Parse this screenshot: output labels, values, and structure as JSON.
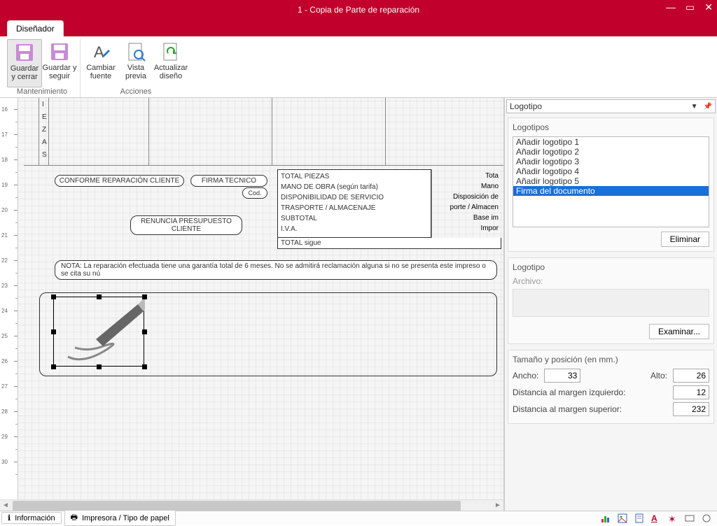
{
  "window": {
    "title": "1 - Copia de Parte de reparación"
  },
  "tab": {
    "designer": "Diseñador"
  },
  "ribbon": {
    "groups": {
      "maintenance": {
        "label": "Mantenimiento",
        "save_close": "Guardar y cerrar",
        "save_continue": "Guardar y seguir"
      },
      "actions": {
        "label": "Acciones",
        "change_font": "Cambiar fuente",
        "preview": "Vista previa",
        "refresh": "Actualizar diseño"
      }
    }
  },
  "ruler": {
    "start": 16,
    "end": 30
  },
  "design": {
    "vertical_letters": [
      "I",
      "E",
      "Z",
      "A",
      "S"
    ],
    "conforme": "CONFORME REPARACIÓN CLIENTE",
    "firma_tecnico": "FIRMA TECNICO",
    "cod": "Cod.",
    "renuncia1": "RENUNCIA PRESUPUESTO",
    "renuncia2": "CLIENTE",
    "totals": [
      "TOTAL PIEZAS",
      "MANO DE OBRA (según tarifa)",
      "DISPONIBILIDAD DE SERVICIO",
      "TRASPORTE / ALMACENAJE",
      "SUBTOTAL",
      "I.V.A."
    ],
    "total_sigue": "TOTAL sigue",
    "right_col": [
      "Tota",
      "Mano",
      "Disposición de",
      "porte / Almacen",
      "Base im",
      "Impor"
    ],
    "nota": "NOTA: La reparación efectuada tiene una garantía total de 6 meses.  No se admitirá reclamación alguna si no se presenta   este impreso o se cita su nú"
  },
  "panel": {
    "header": "Logotipo",
    "logos_title": "Logotipos",
    "logos": [
      "Añadir logotipo 1",
      "Añadir logotipo 2",
      "Añadir logotipo 3",
      "Añadir logotipo 4",
      "Añadir logotipo 5",
      "Firma del documento"
    ],
    "selected_logo_index": 5,
    "delete_btn": "Eliminar",
    "logo_section": "Logotipo",
    "file_label": "Archivo:",
    "browse_btn": "Examinar...",
    "size_title": "Tamaño y posición (en mm.)",
    "ancho_label": "Ancho:",
    "ancho": "33",
    "alto_label": "Alto:",
    "alto": "26",
    "dist_izq_label": "Distancia al margen izquierdo:",
    "dist_izq": "12",
    "dist_sup_label": "Distancia al margen superior:",
    "dist_sup": "232"
  },
  "status": {
    "info": "Información",
    "printer": "Impresora / Tipo de papel"
  }
}
